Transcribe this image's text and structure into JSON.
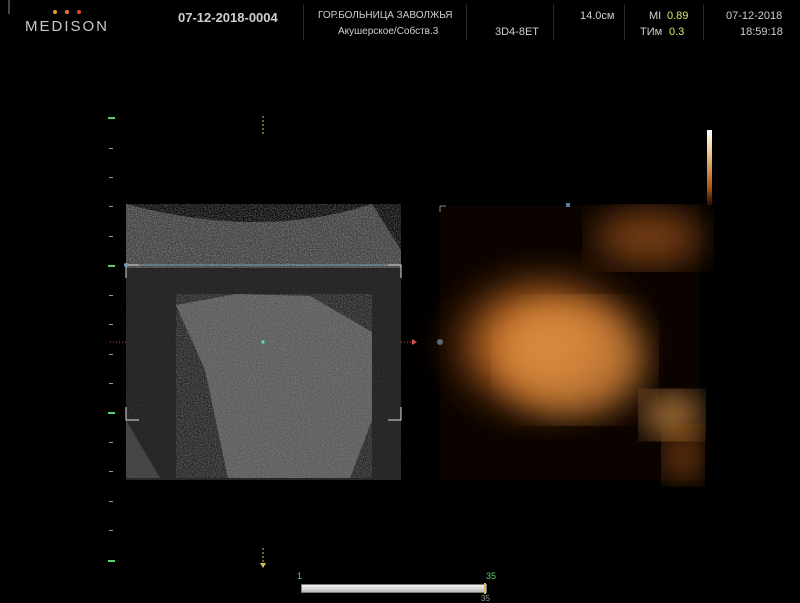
{
  "header": {
    "brand": "MEDISON",
    "brand_dot_colors": [
      "#e8a028",
      "#e87a28",
      "#e04a30"
    ],
    "patient_id": "07-12-2018-0004",
    "hospital": "ГОР.БОЛЬНИЦА ЗАВОЛЖЬЯ",
    "exam_preset": "Акушерское/Собств.3",
    "probe": "3D4-8ET",
    "depth": "14.0см",
    "mi_label": "MI",
    "mi_value": "0.89",
    "ti_label": "ТИм",
    "ti_value": "0.3",
    "date": "07-12-2018",
    "time": "18:59:18"
  },
  "volume_bar": {
    "start_label": "1",
    "end_label": "35",
    "position": "35"
  },
  "colors": {
    "accent": "#5fd06f",
    "render_tint": "#c87a30",
    "marker": "#e05050"
  }
}
